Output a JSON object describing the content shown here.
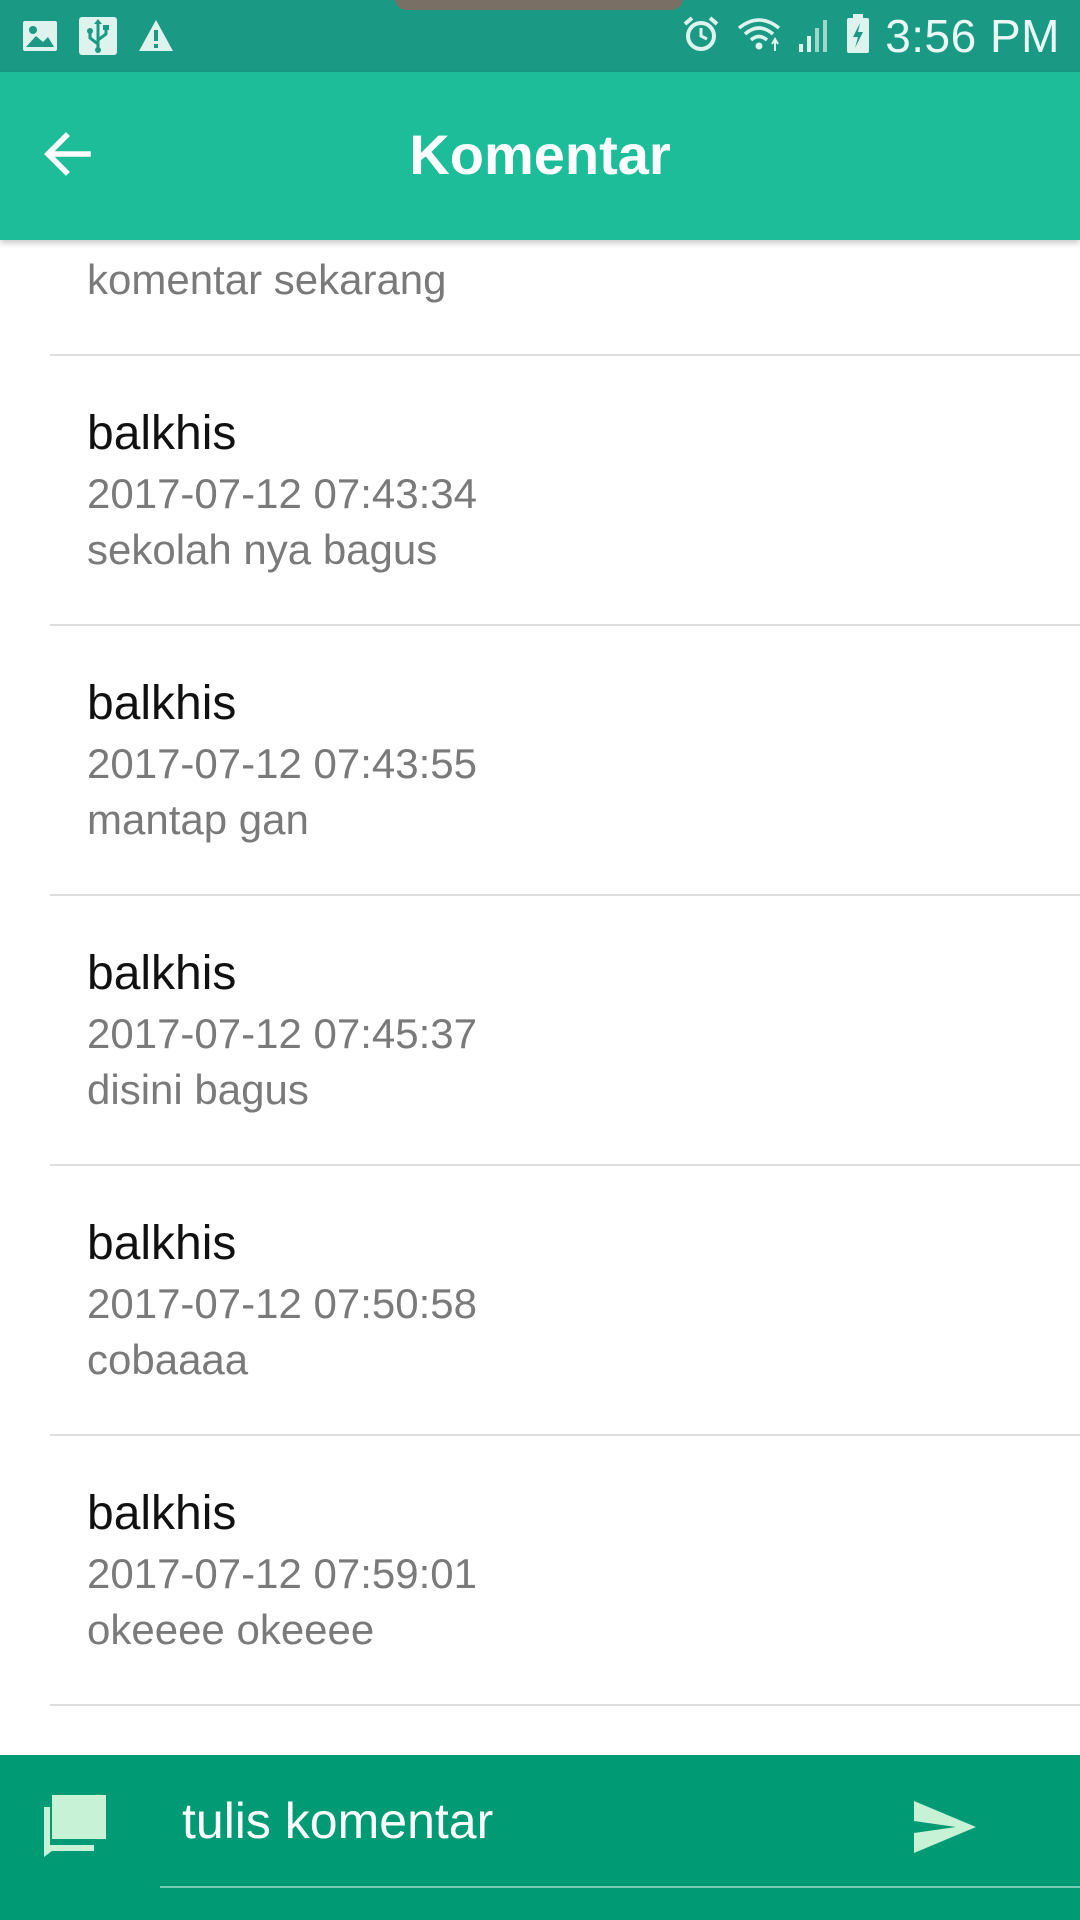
{
  "status_bar": {
    "time": "3:56 PM",
    "left_icons": [
      "image-icon",
      "usb-icon",
      "warning-icon"
    ],
    "right_icons": [
      "alarm-icon",
      "wifi-icon",
      "signal-icon",
      "battery-charging-icon"
    ]
  },
  "toolbar": {
    "title": "Komentar",
    "back_icon": "arrow-left-icon"
  },
  "comments": {
    "partial_top_message": "komentar sekarang",
    "items": [
      {
        "author": "balkhis",
        "timestamp": "2017-07-12 07:43:34",
        "message": "sekolah nya bagus"
      },
      {
        "author": "balkhis",
        "timestamp": "2017-07-12 07:43:55",
        "message": "mantap gan"
      },
      {
        "author": "balkhis",
        "timestamp": "2017-07-12 07:45:37",
        "message": "disini bagus"
      },
      {
        "author": "balkhis",
        "timestamp": "2017-07-12 07:50:58",
        "message": "cobaaaa"
      },
      {
        "author": "balkhis",
        "timestamp": "2017-07-12 07:59:01",
        "message": "okeeee okeeee"
      }
    ]
  },
  "input_bar": {
    "placeholder": "tulis komentar",
    "value": "",
    "left_icon": "comment-icon",
    "send_icon": "send-icon"
  },
  "colors": {
    "status_bar": "#1a9a85",
    "toolbar": "#1dbd9a",
    "input_bar": "#009b74",
    "divider": "#dedede",
    "secondary_text": "#7a7a7a"
  }
}
